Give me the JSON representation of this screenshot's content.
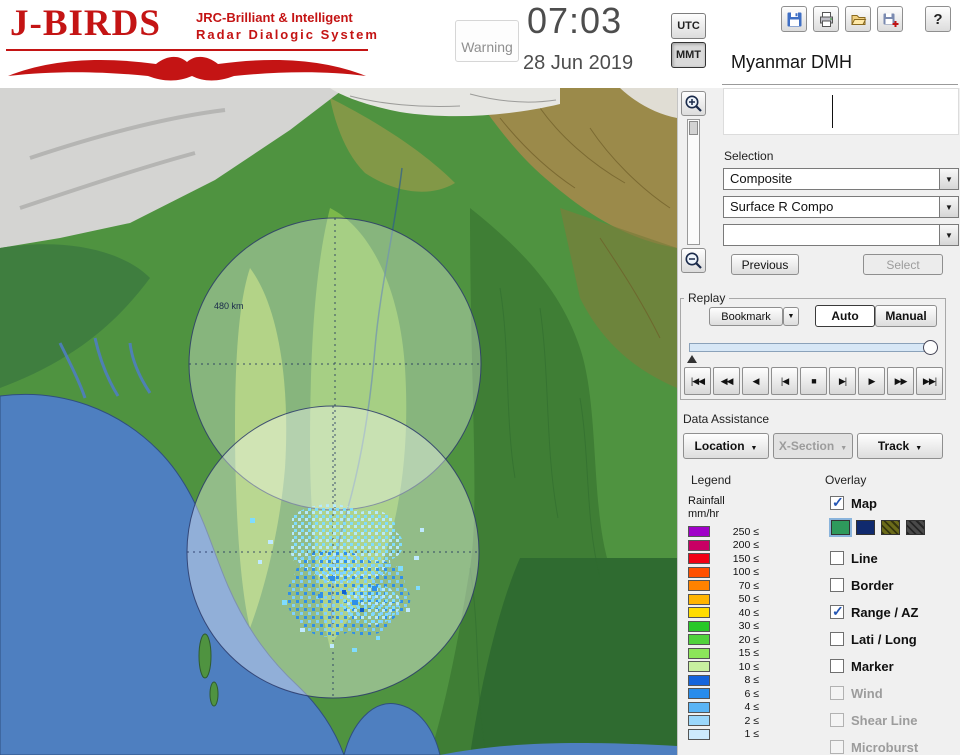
{
  "header": {
    "logo": {
      "title": "J-BIRDS",
      "subtitle1": "JRC-Brilliant & Intelligent",
      "subtitle2": "Radar Dialogic System"
    },
    "warning_label": "Warning",
    "time": "07:03",
    "date": "28 Jun 2019",
    "tz": [
      {
        "label": "UTC",
        "active": false
      },
      {
        "label": "MMT",
        "active": true
      }
    ],
    "station_name": "Myanmar DMH"
  },
  "icons": {
    "dropdown": "▼",
    "help": "?"
  },
  "map": {
    "range_label": "480 km"
  },
  "selection": {
    "label": "Selection",
    "combo1": "Composite",
    "combo2": "Surface R Compo",
    "combo3": "",
    "previous_label": "Previous",
    "select_label": "Select",
    "select_disabled": true
  },
  "replay": {
    "label": "Replay",
    "bookmark_label": "Bookmark",
    "auto_label": "Auto",
    "manual_label": "Manual",
    "auto_active": true,
    "transport": [
      "|◀◀",
      "◀◀",
      "◀",
      "|◀",
      "■",
      "▶|",
      "▶",
      "▶▶",
      "▶▶|"
    ]
  },
  "data_assistance": {
    "label": "Data Assistance",
    "location_label": "Location",
    "xsection_label": "X-Section",
    "xsection_disabled": true,
    "track_label": "Track"
  },
  "legend": {
    "title": "Legend",
    "unit_line1": "Rainfall",
    "unit_line2": "mm/hr",
    "rows": [
      {
        "value": "250 ≤",
        "color": "#a000c8"
      },
      {
        "value": "200 ≤",
        "color": "#c80064"
      },
      {
        "value": "150 ≤",
        "color": "#f00014"
      },
      {
        "value": "100 ≤",
        "color": "#ff5000"
      },
      {
        "value": "70 ≤",
        "color": "#ff8200"
      },
      {
        "value": "50 ≤",
        "color": "#ffb400"
      },
      {
        "value": "40 ≤",
        "color": "#ffdc00"
      },
      {
        "value": "30 ≤",
        "color": "#28c828"
      },
      {
        "value": "20 ≤",
        "color": "#50d23c"
      },
      {
        "value": "15 ≤",
        "color": "#8ce65a"
      },
      {
        "value": "10 ≤",
        "color": "#c8f0a0"
      },
      {
        "value": "8 ≤",
        "color": "#1464dc"
      },
      {
        "value": "6 ≤",
        "color": "#288ceb"
      },
      {
        "value": "4 ≤",
        "color": "#5ab4f5"
      },
      {
        "value": "2 ≤",
        "color": "#9bd7fb"
      },
      {
        "value": "1 ≤",
        "color": "#cdeafd"
      }
    ]
  },
  "overlay": {
    "title": "Overlay",
    "map_colors": [
      "#2e9a5c",
      "#102a6e",
      "#6b6b1a",
      "#4a4a4a"
    ],
    "items": [
      {
        "label": "Map",
        "checked": true,
        "disabled": false
      },
      {
        "label": "Line",
        "checked": false,
        "disabled": false
      },
      {
        "label": "Border",
        "checked": false,
        "disabled": false
      },
      {
        "label": "Range / AZ",
        "checked": true,
        "disabled": false
      },
      {
        "label": "Lati / Long",
        "checked": false,
        "disabled": false
      },
      {
        "label": "Marker",
        "checked": false,
        "disabled": false
      },
      {
        "label": "Wind",
        "checked": false,
        "disabled": true
      },
      {
        "label": "Shear Line",
        "checked": false,
        "disabled": true
      },
      {
        "label": "Microburst",
        "checked": false,
        "disabled": true
      }
    ]
  }
}
